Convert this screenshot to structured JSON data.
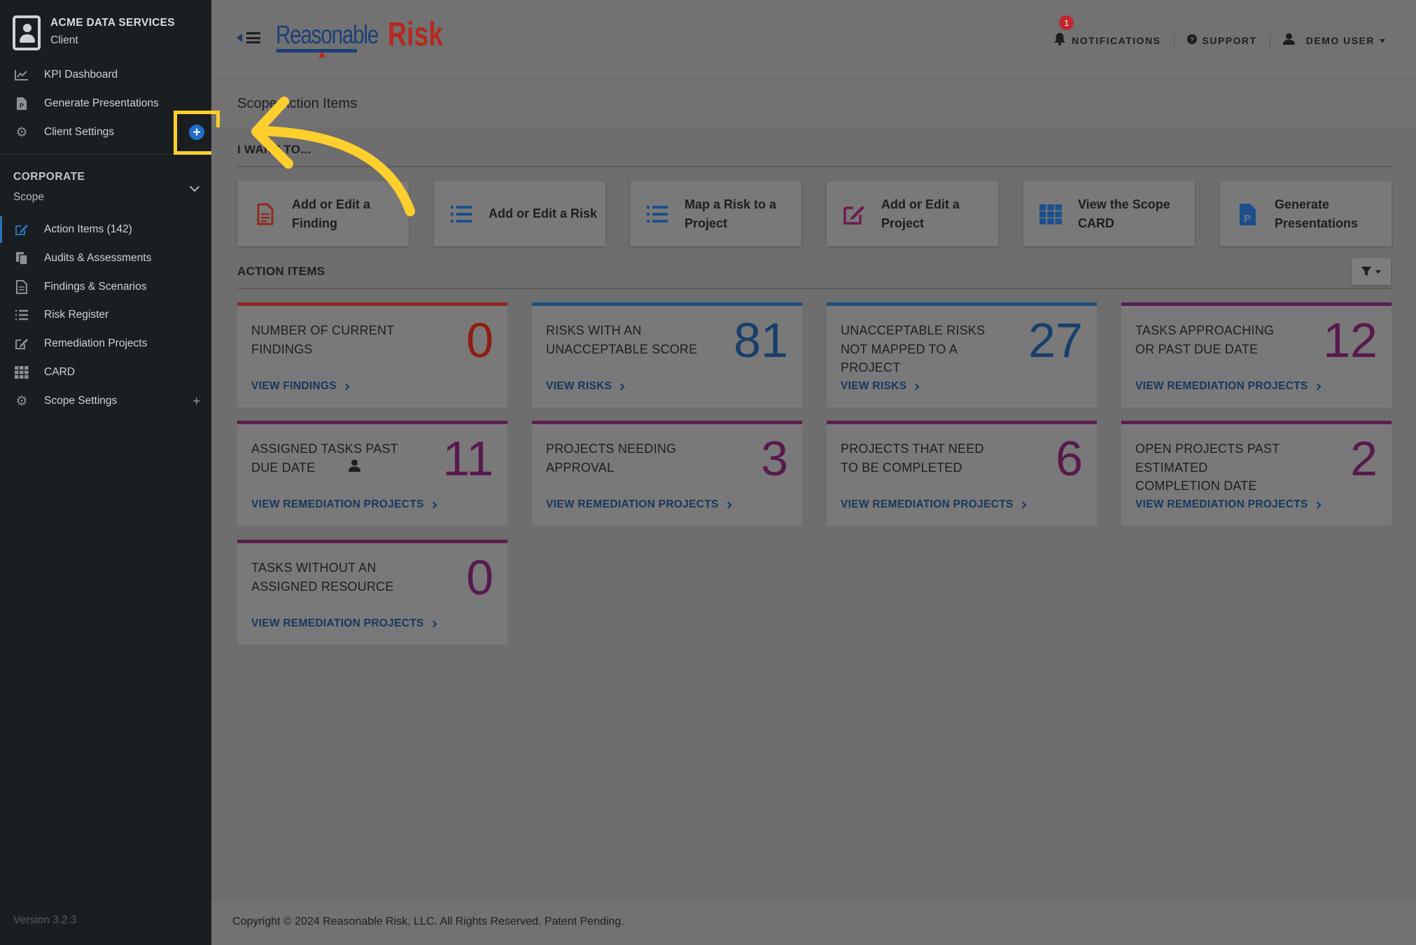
{
  "sidebar": {
    "org_name": "ACME DATA SERVICES",
    "org_role": "Client",
    "top_items": [
      {
        "label": "KPI Dashboard",
        "icon": "chart-line-icon"
      },
      {
        "label": "Generate Presentations",
        "icon": "file-powerpoint-icon"
      },
      {
        "label": "Client Settings",
        "icon": "gear-icon"
      }
    ],
    "section_title": "CORPORATE",
    "section_sub": "Scope",
    "scope_items": [
      {
        "label": "Action Items (142)",
        "icon": "edit-icon",
        "active": true
      },
      {
        "label": "Audits & Assessments",
        "icon": "copy-icon"
      },
      {
        "label": "Findings & Scenarios",
        "icon": "document-icon"
      },
      {
        "label": "Risk Register",
        "icon": "list-icon"
      },
      {
        "label": "Remediation Projects",
        "icon": "edit-icon"
      },
      {
        "label": "CARD",
        "icon": "grid-icon"
      },
      {
        "label": "Scope Settings",
        "icon": "gear-icon"
      }
    ],
    "scope_settings_plus": "+",
    "add_button_label": "+",
    "version": "Version 3.2.3"
  },
  "header": {
    "logo_part1": "Reasonable",
    "logo_part2": "Risk",
    "notifications_label": "NOTIFICATIONS",
    "notifications_count": "1",
    "support_label": "SUPPORT",
    "user_label": "DEMO USER"
  },
  "page_title": "Scope Action Items",
  "i_want_to": {
    "heading": "I WANT TO...",
    "actions": [
      {
        "label": "Add or Edit a Finding",
        "icon": "file-icon",
        "color": "#a52a2a"
      },
      {
        "label": "Add or Edit a Risk",
        "icon": "list-icon",
        "color": "#1c4f8c"
      },
      {
        "label": "Map a Risk to a Project",
        "icon": "list-icon",
        "color": "#1c4f8c"
      },
      {
        "label": "Add or Edit a Project",
        "icon": "edit-icon",
        "color": "#6b1c4f"
      },
      {
        "label": "View the Scope CARD",
        "icon": "grid-icon",
        "color": "#1c4f8c"
      },
      {
        "label": "Generate Presentations",
        "icon": "file-powerpoint-icon",
        "color": "#1c4f8c"
      }
    ]
  },
  "action_items": {
    "heading": "ACTION ITEMS",
    "cards": [
      {
        "label": "NUMBER OF CURRENT FINDINGS",
        "value": "0",
        "link": "VIEW FINDINGS",
        "color": "#8e1d12",
        "top": "#8e2a1e"
      },
      {
        "label": "RISKS WITH AN UNACCEPTABLE SCORE",
        "value": "81",
        "link": "VIEW RISKS",
        "color": "#173f6a",
        "top": "#1d4f7a"
      },
      {
        "label": "UNACCEPTABLE RISKS NOT MAPPED TO A PROJECT",
        "value": "27",
        "link": "VIEW RISKS",
        "color": "#173f6a",
        "top": "#1d4f7a"
      },
      {
        "label": "TASKS APPROACHING OR PAST DUE DATE",
        "value": "12",
        "link": "VIEW REMEDIATION PROJECTS",
        "color": "#581a4d",
        "top": "#5a1f4f"
      },
      {
        "label": "ASSIGNED TASKS PAST DUE DATE",
        "value": "11",
        "link": "VIEW REMEDIATION PROJECTS",
        "color": "#581a4d",
        "top": "#5a1f4f",
        "user_icon": true
      },
      {
        "label": "PROJECTS NEEDING APPROVAL",
        "value": "3",
        "link": "VIEW REMEDIATION PROJECTS",
        "color": "#581a4d",
        "top": "#5a1f4f"
      },
      {
        "label": "PROJECTS THAT NEED TO BE COMPLETED",
        "value": "6",
        "link": "VIEW REMEDIATION PROJECTS",
        "color": "#581a4d",
        "top": "#5a1f4f"
      },
      {
        "label": "OPEN PROJECTS PAST ESTIMATED COMPLETION DATE",
        "value": "2",
        "link": "VIEW REMEDIATION PROJECTS",
        "color": "#581a4d",
        "top": "#5a1f4f"
      },
      {
        "label": "TASKS WITHOUT AN ASSIGNED RESOURCE",
        "value": "0",
        "link": "VIEW REMEDIATION PROJECTS",
        "color": "#581a4d",
        "top": "#5a1f4f"
      }
    ]
  },
  "footer": "Copyright © 2024 Reasonable Risk, LLC. All Rights Reserved. Patent Pending.",
  "annotation_color": "#ffcf2e"
}
